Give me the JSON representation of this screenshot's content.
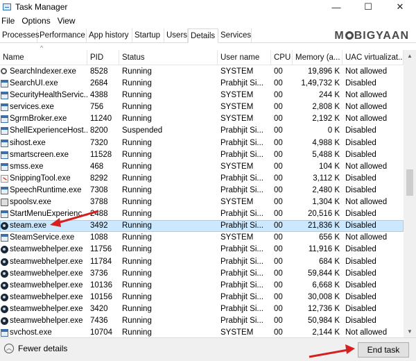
{
  "window": {
    "title": "Task Manager",
    "minimize_glyph": "—",
    "maximize_glyph": "☐",
    "close_glyph": "✕"
  },
  "menu": [
    "File",
    "Options",
    "View"
  ],
  "tabs": [
    {
      "label": "Processes",
      "active": false
    },
    {
      "label": "Performance",
      "active": false
    },
    {
      "label": "App history",
      "active": false
    },
    {
      "label": "Startup",
      "active": false
    },
    {
      "label": "Users",
      "active": false
    },
    {
      "label": "Details",
      "active": true
    },
    {
      "label": "Services",
      "active": false
    }
  ],
  "brand": {
    "pre": "M",
    "post": "BIGYAAN"
  },
  "columns": {
    "name": "Name",
    "pid": "PID",
    "status": "Status",
    "user": "User name",
    "cpu": "CPU",
    "memory": "Memory (a...",
    "uac": "UAC virtualizat..."
  },
  "rows": [
    {
      "icon": "search-icon",
      "name": "SearchIndexer.exe",
      "pid": "8528",
      "status": "Running",
      "user": "SYSTEM",
      "cpu": "00",
      "memory": "19,896 K",
      "uac": "Not allowed"
    },
    {
      "icon": "window-icon",
      "name": "SearchUI.exe",
      "pid": "2684",
      "status": "Running",
      "user": "Prabhjit Si...",
      "cpu": "00",
      "memory": "1,49,732 K",
      "uac": "Disabled"
    },
    {
      "icon": "window-icon",
      "name": "SecurityHealthServic...",
      "pid": "4388",
      "status": "Running",
      "user": "SYSTEM",
      "cpu": "00",
      "memory": "244 K",
      "uac": "Not allowed"
    },
    {
      "icon": "window-icon",
      "name": "services.exe",
      "pid": "756",
      "status": "Running",
      "user": "SYSTEM",
      "cpu": "00",
      "memory": "2,808 K",
      "uac": "Not allowed"
    },
    {
      "icon": "window-icon",
      "name": "SgrmBroker.exe",
      "pid": "11240",
      "status": "Running",
      "user": "SYSTEM",
      "cpu": "00",
      "memory": "2,192 K",
      "uac": "Not allowed"
    },
    {
      "icon": "window-icon",
      "name": "ShellExperienceHost...",
      "pid": "8200",
      "status": "Suspended",
      "user": "Prabhjit Si...",
      "cpu": "00",
      "memory": "0 K",
      "uac": "Disabled"
    },
    {
      "icon": "window-icon",
      "name": "sihost.exe",
      "pid": "7320",
      "status": "Running",
      "user": "Prabhjit Si...",
      "cpu": "00",
      "memory": "4,988 K",
      "uac": "Disabled"
    },
    {
      "icon": "window-icon",
      "name": "smartscreen.exe",
      "pid": "11528",
      "status": "Running",
      "user": "Prabhjit Si...",
      "cpu": "00",
      "memory": "5,488 K",
      "uac": "Disabled"
    },
    {
      "icon": "window-icon",
      "name": "smss.exe",
      "pid": "468",
      "status": "Running",
      "user": "SYSTEM",
      "cpu": "00",
      "memory": "104 K",
      "uac": "Not allowed"
    },
    {
      "icon": "snipping-icon",
      "name": "SnippingTool.exe",
      "pid": "8292",
      "status": "Running",
      "user": "Prabhjit Si...",
      "cpu": "00",
      "memory": "3,112 K",
      "uac": "Disabled"
    },
    {
      "icon": "window-icon",
      "name": "SpeechRuntime.exe",
      "pid": "7308",
      "status": "Running",
      "user": "Prabhjit Si...",
      "cpu": "00",
      "memory": "2,480 K",
      "uac": "Disabled"
    },
    {
      "icon": "printer-icon",
      "name": "spoolsv.exe",
      "pid": "3788",
      "status": "Running",
      "user": "SYSTEM",
      "cpu": "00",
      "memory": "1,304 K",
      "uac": "Not allowed"
    },
    {
      "icon": "window-icon",
      "name": "StartMenuExperienc...",
      "pid": "2488",
      "status": "Running",
      "user": "Prabhjit Si...",
      "cpu": "00",
      "memory": "20,516 K",
      "uac": "Disabled"
    },
    {
      "icon": "steam-icon",
      "name": "steam.exe",
      "pid": "3492",
      "status": "Running",
      "user": "Prabhjit Si...",
      "cpu": "00",
      "memory": "21,836 K",
      "uac": "Disabled",
      "selected": true
    },
    {
      "icon": "window-icon",
      "name": "SteamService.exe",
      "pid": "1088",
      "status": "Running",
      "user": "SYSTEM",
      "cpu": "00",
      "memory": "656 K",
      "uac": "Not allowed"
    },
    {
      "icon": "steam-icon",
      "name": "steamwebhelper.exe",
      "pid": "11756",
      "status": "Running",
      "user": "Prabhjit Si...",
      "cpu": "00",
      "memory": "11,916 K",
      "uac": "Disabled"
    },
    {
      "icon": "steam-icon",
      "name": "steamwebhelper.exe",
      "pid": "11784",
      "status": "Running",
      "user": "Prabhjit Si...",
      "cpu": "00",
      "memory": "684 K",
      "uac": "Disabled"
    },
    {
      "icon": "steam-icon",
      "name": "steamwebhelper.exe",
      "pid": "3736",
      "status": "Running",
      "user": "Prabhjit Si...",
      "cpu": "00",
      "memory": "59,844 K",
      "uac": "Disabled"
    },
    {
      "icon": "steam-icon",
      "name": "steamwebhelper.exe",
      "pid": "10136",
      "status": "Running",
      "user": "Prabhjit Si...",
      "cpu": "00",
      "memory": "6,668 K",
      "uac": "Disabled"
    },
    {
      "icon": "steam-icon",
      "name": "steamwebhelper.exe",
      "pid": "10156",
      "status": "Running",
      "user": "Prabhjit Si...",
      "cpu": "00",
      "memory": "30,008 K",
      "uac": "Disabled"
    },
    {
      "icon": "steam-icon",
      "name": "steamwebhelper.exe",
      "pid": "3420",
      "status": "Running",
      "user": "Prabhjit Si...",
      "cpu": "00",
      "memory": "12,736 K",
      "uac": "Disabled"
    },
    {
      "icon": "steam-icon",
      "name": "steamwebhelper.exe",
      "pid": "7436",
      "status": "Running",
      "user": "Prabhjit Si...",
      "cpu": "00",
      "memory": "50,984 K",
      "uac": "Disabled"
    },
    {
      "icon": "window-icon",
      "name": "svchost.exe",
      "pid": "10704",
      "status": "Running",
      "user": "SYSTEM",
      "cpu": "00",
      "memory": "2,144 K",
      "uac": "Not allowed"
    }
  ],
  "footer": {
    "fewer_details": "Fewer details",
    "end_task": "End task"
  },
  "colors": {
    "selection": "#cce8ff",
    "arrow": "#d62020"
  }
}
